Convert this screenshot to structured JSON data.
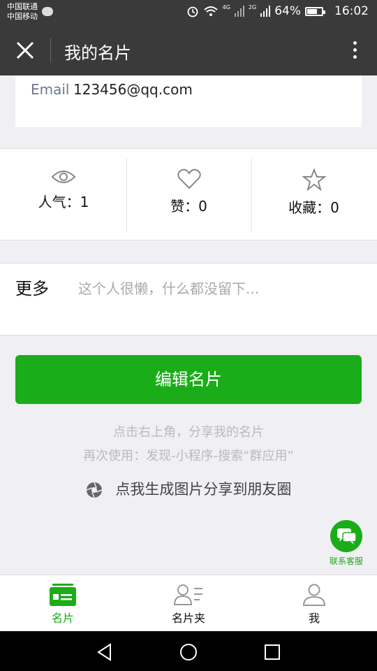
{
  "statusbar": {
    "carrier1": "中国联通",
    "carrier2": "中国移动",
    "signal1": "4G",
    "signal2": "2G",
    "battery_percent": "64%",
    "time": "16:02"
  },
  "titlebar": {
    "title": "我的名片"
  },
  "card": {
    "email_label": "Email",
    "email_value": "123456@qq.com"
  },
  "stats": [
    {
      "label": "人气：1",
      "icon": "eye-icon"
    },
    {
      "label": "赞：0",
      "icon": "heart-icon"
    },
    {
      "label": "收藏：0",
      "icon": "star-icon"
    }
  ],
  "more": {
    "label": "更多",
    "placeholder": "这个人很懒，什么都没留下..."
  },
  "edit_button": "编辑名片",
  "hints": {
    "line1": "点击右上角，分享我的名片",
    "line2": "再次使用：发现-小程序-搜索“群应用”"
  },
  "share": {
    "label": "点我生成图片分享到朋友圈",
    "icon": "camera-aperture-icon"
  },
  "customer_service": {
    "label": "联系客服"
  },
  "tabbar": [
    {
      "label": "名片",
      "active": true,
      "icon": "card-icon"
    },
    {
      "label": "名片夹",
      "active": false,
      "icon": "contacts-icon"
    },
    {
      "label": "我",
      "active": false,
      "icon": "person-icon"
    }
  ],
  "colors": {
    "accent": "#1aad19",
    "header": "#3a3a3a",
    "background": "#efeff4"
  }
}
